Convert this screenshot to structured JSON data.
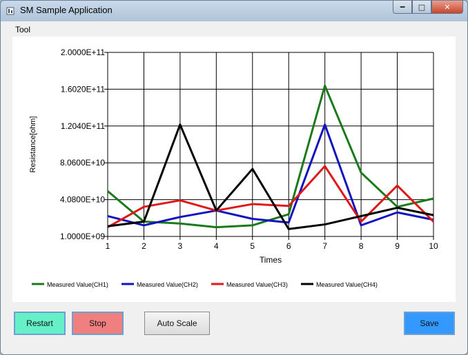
{
  "window": {
    "title": "SM Sample Application"
  },
  "menu": {
    "items": [
      "Tool"
    ]
  },
  "buttons": {
    "restart": "Restart",
    "stop": "Stop",
    "auto_scale": "Auto Scale",
    "save": "Save"
  },
  "chart_data": {
    "type": "line",
    "xlabel": "Times",
    "ylabel": "Resistance[ohm]",
    "x": [
      1,
      2,
      3,
      4,
      5,
      6,
      7,
      8,
      9,
      10
    ],
    "xlim": [
      1,
      10
    ],
    "ylim": [
      1000000000,
      200000000000
    ],
    "ytick_labels": [
      "1.0000E+09",
      "4.0800E+10",
      "8.0600E+10",
      "1.2040E+11",
      "1.6020E+11",
      "2.0000E+11"
    ],
    "ytick_values": [
      1000000000,
      40800000000,
      80600000000,
      120400000000,
      160200000000,
      200000000000
    ],
    "grid": true,
    "legend_position": "bottom",
    "series": [
      {
        "name": "Measured Value(CH1)",
        "color": "#1a7a1a",
        "values": [
          50000000000,
          17000000000,
          15000000000,
          11000000000,
          13000000000,
          25000000000,
          164000000000,
          70000000000,
          33000000000,
          42000000000
        ]
      },
      {
        "name": "Measured Value(CH2)",
        "color": "#1212c0",
        "values": [
          23000000000,
          13000000000,
          22000000000,
          29000000000,
          20000000000,
          16000000000,
          122000000000,
          13000000000,
          27000000000,
          19000000000
        ]
      },
      {
        "name": "Measured Value(CH3)",
        "color": "#e01818",
        "values": [
          11000000000,
          33000000000,
          40000000000,
          29000000000,
          36000000000,
          34000000000,
          77000000000,
          17000000000,
          56000000000,
          17000000000
        ]
      },
      {
        "name": "Measured Value(CH4)",
        "color": "#000000",
        "values": [
          12000000000,
          17000000000,
          122000000000,
          29000000000,
          74000000000,
          9000000000,
          14000000000,
          23000000000,
          32000000000,
          24000000000
        ]
      }
    ]
  }
}
